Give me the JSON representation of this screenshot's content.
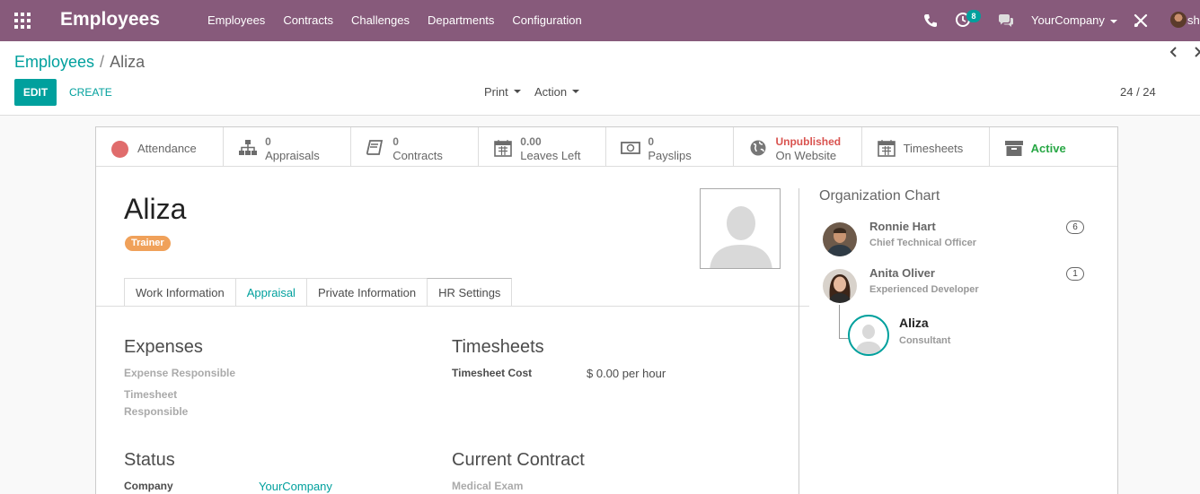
{
  "navbar": {
    "brand": "Employees",
    "menu": [
      "Employees",
      "Contracts",
      "Challenges",
      "Departments",
      "Configuration"
    ],
    "activity_count": "8",
    "company": "YourCompany",
    "user": "sh",
    "icons": [
      "apps-icon",
      "phone-icon",
      "activity-icon",
      "chat-icon",
      "tools-icon"
    ]
  },
  "breadcrumb": {
    "root": "Employees",
    "separator": "/",
    "current": "Aliza"
  },
  "buttons": {
    "edit": "EDIT",
    "create": "CREATE",
    "print": "Print",
    "action": "Action"
  },
  "pager": {
    "value": "24 / 24"
  },
  "smart_buttons": [
    {
      "label": "Attendance",
      "icon": "attendance-dot-icon"
    },
    {
      "value": "0",
      "label": "Appraisals",
      "icon": "sitemap-icon"
    },
    {
      "value": "0",
      "label": "Contracts",
      "icon": "book-icon"
    },
    {
      "value": "0.00",
      "label": "Leaves Left",
      "icon": "calendar-icon"
    },
    {
      "value": "0",
      "label": "Payslips",
      "icon": "money-icon"
    },
    {
      "value": "Unpublished",
      "label": "On Website",
      "icon": "globe-icon"
    },
    {
      "label": "Timesheets",
      "icon": "calendar-icon"
    },
    {
      "label": "Active",
      "icon": "archive-icon"
    }
  ],
  "employee": {
    "name": "Aliza",
    "tag": "Trainer"
  },
  "tabs": [
    "Work Information",
    "Appraisal",
    "Private Information",
    "HR Settings"
  ],
  "sections": {
    "expenses": {
      "title": "Expenses",
      "expense_responsible": "Expense Responsible",
      "timesheet_responsible_1": "Timesheet",
      "timesheet_responsible_2": "Responsible"
    },
    "timesheets": {
      "title": "Timesheets",
      "cost_label": "Timesheet Cost",
      "cost_value": "$ 0.00 per hour"
    },
    "status": {
      "title": "Status",
      "company_label": "Company",
      "company_value": "YourCompany"
    },
    "contract": {
      "title": "Current Contract",
      "medical_exam": "Medical Exam"
    }
  },
  "org_chart": {
    "title": "Organization Chart",
    "managers": [
      {
        "name": "Ronnie Hart",
        "job": "Chief Technical Officer",
        "count": "6"
      },
      {
        "name": "Anita Oliver",
        "job": "Experienced Developer",
        "count": "1"
      }
    ],
    "self": {
      "name": "Aliza",
      "job": "Consultant"
    }
  },
  "colors": {
    "navbar": "#875a7b",
    "accent": "#00a09d",
    "tag": "#f0a15a",
    "unpublished": "#d9534f",
    "active": "#28a745"
  }
}
